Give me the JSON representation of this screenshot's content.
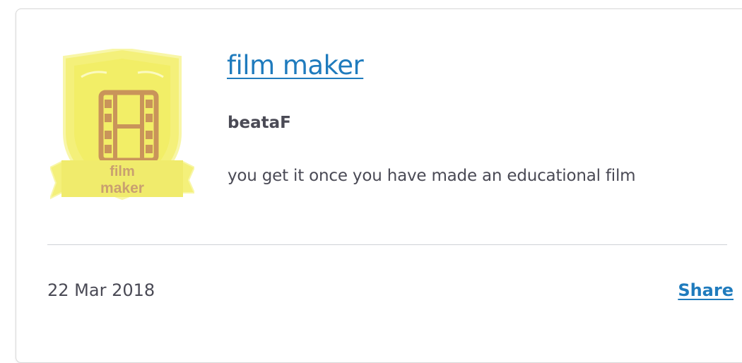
{
  "badge": {
    "title": "film maker",
    "author": "beataF",
    "description": "you get it once you have made an educational film",
    "image": {
      "icon": "film-strip-icon",
      "ribbon_line1": "film",
      "ribbon_line2": "maker"
    }
  },
  "footer": {
    "date": "22 Mar 2018",
    "share_label": "Share"
  },
  "colors": {
    "link": "#1f7bbd",
    "text": "#4a4a55",
    "badge_yellow": "#f4f07a",
    "badge_brown": "#c9945a"
  }
}
